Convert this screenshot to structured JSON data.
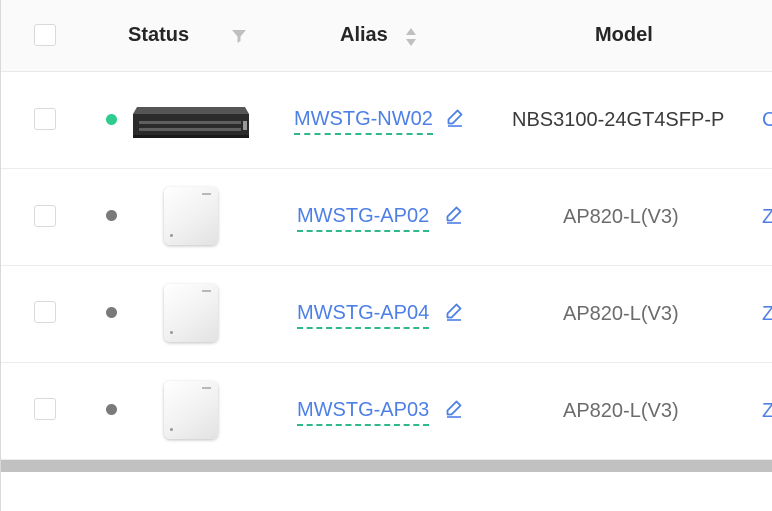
{
  "header": {
    "status_label": "Status",
    "alias_label": "Alias",
    "model_label": "Model",
    "status_filter_icon": "filter-icon",
    "alias_sort_icon": "sort-icon"
  },
  "rows": [
    {
      "status": "online",
      "status_color": "#2ecc8f",
      "device_image": "switch",
      "alias": "MWSTG-NW02",
      "model": "NBS3100-24GT4SFP-P",
      "next_col_fragment": "C"
    },
    {
      "status": "offline",
      "status_color": "#7a7a7a",
      "device_image": "access-point",
      "alias": "MWSTG-AP02",
      "model": "AP820-L(V3)",
      "next_col_fragment": "Z"
    },
    {
      "status": "offline",
      "status_color": "#7a7a7a",
      "device_image": "access-point",
      "alias": "MWSTG-AP04",
      "model": "AP820-L(V3)",
      "next_col_fragment": "Z"
    },
    {
      "status": "offline",
      "status_color": "#7a7a7a",
      "device_image": "access-point",
      "alias": "MWSTG-AP03",
      "model": "AP820-L(V3)",
      "next_col_fragment": "Z"
    }
  ],
  "colors": {
    "link": "#4d7fe6",
    "online": "#2ecc8f",
    "offline": "#7a7a7a",
    "underline": "#2fb88a"
  }
}
